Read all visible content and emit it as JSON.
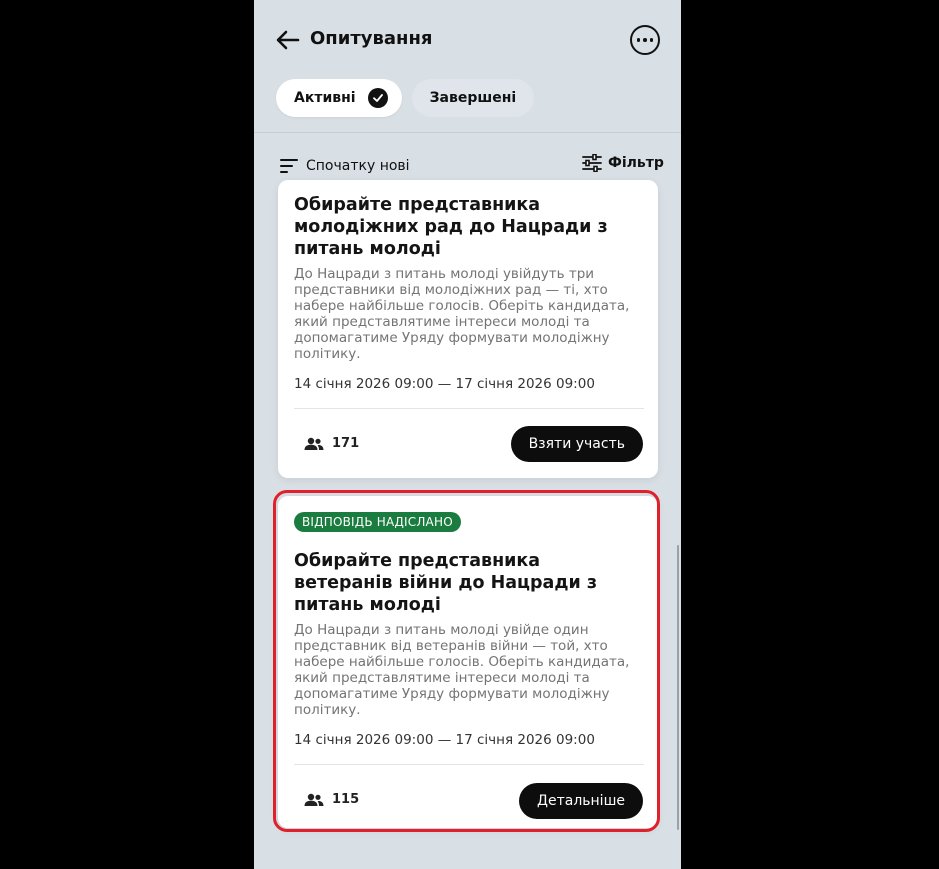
{
  "header": {
    "title": "Опитування",
    "back_icon": "arrow-left-icon",
    "more_icon": "more-horizontal-icon"
  },
  "tabs": [
    {
      "label": "Активні",
      "active": true
    },
    {
      "label": "Завершені",
      "active": false
    }
  ],
  "toolbar": {
    "sort_label": "Спочатку нові",
    "filter_label": "Фільтр"
  },
  "polls": [
    {
      "title": "Обирайте представника молодіжних рад до Нацради з питань молоді",
      "description": "До Нацради з питань молоді увійдуть три представники від молодіжних рад — ті, хто набере найбільше голосів. Оберіть кандидата, який представлятиме інтереси молоді та допомагатиме Уряду формувати молодіжну політику.",
      "dates": "14 січня 2026 09:00 — 17 січня 2026 09:00",
      "participants": "171",
      "button_label": "Взяти участь"
    },
    {
      "badge": "ВІДПОВІДЬ НАДІСЛАНО",
      "title": "Обирайте представника ветеранів війни до Нацради з питань молоді",
      "description": "До Нацради з питань молоді увійде один представник від ветеранів війни — той, хто набере найбільше голосів. Оберіть кандидата, який представлятиме інтереси молоді та допомагатиме Уряду формувати молодіжну політику.",
      "dates": "14 січня 2026 09:00 — 17 січня 2026 09:00",
      "participants": "115",
      "button_label": "Детальніше"
    }
  ],
  "colors": {
    "background": "#d8dfe5",
    "badge_green": "#1a7d3f",
    "highlight_red": "#e0202a",
    "button_black": "#0d0d0d"
  }
}
